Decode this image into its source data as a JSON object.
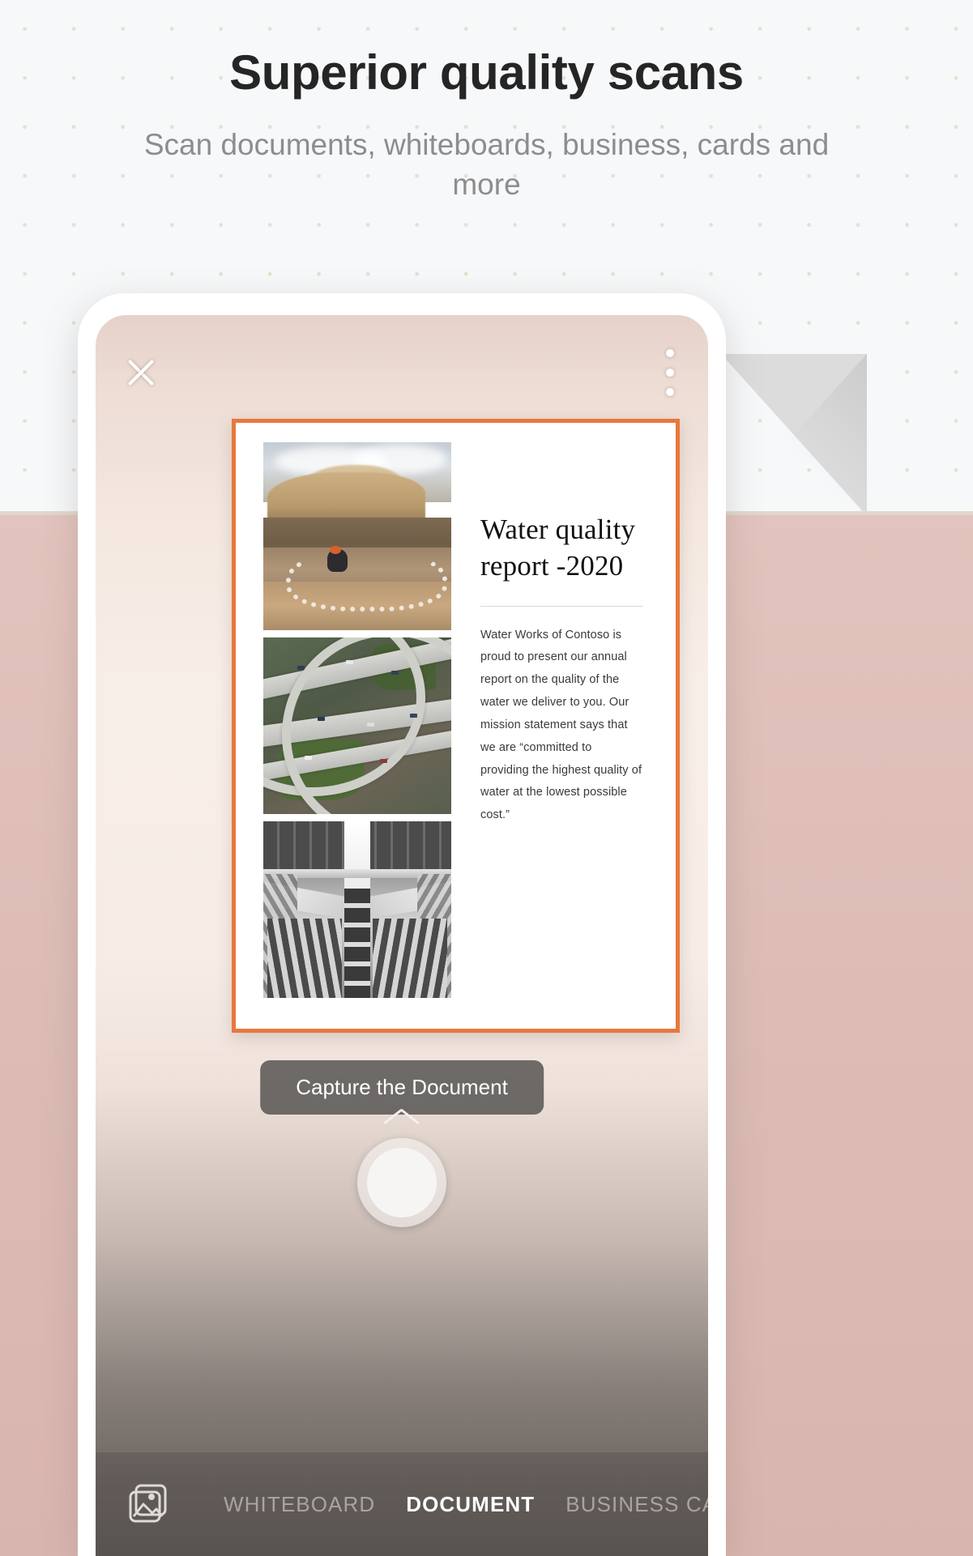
{
  "hero": {
    "headline": "Superior quality scans",
    "subhead": "Scan documents, whiteboards, business, cards and more"
  },
  "colors": {
    "accent_orange": "#e8783c",
    "page_bg_top": "#f6f8fa",
    "page_bg_bottom": "#debdb7",
    "dot_color": "#e6e0cf",
    "pill_bg": "#545250"
  },
  "phone": {
    "topbar": {
      "close_icon": "close-icon",
      "more_icon": "more-vertical-icon",
      "flash_icon": "flash-auto-icon"
    },
    "capture_hint": "Capture the Document",
    "chevron_icon": "chevron-up-icon",
    "shutter_label": "shutter-button",
    "gallery_icon": "gallery-icon",
    "modes": [
      {
        "label": "WHITEBOARD",
        "active": false
      },
      {
        "label": "DOCUMENT",
        "active": true
      },
      {
        "label": "BUSINESS CARD",
        "active": false
      }
    ]
  },
  "document": {
    "title": "Water quality report -2020",
    "body": "Water Works of Contoso is proud to present our annual report on the quality of the water we deliver to you. Our mission statement says that we are “committed to providing the highest quality of water at the lowest possible cost.”",
    "photos": [
      {
        "name": "wetland-erosion-photo"
      },
      {
        "name": "aerial-highway-interchange-photo"
      },
      {
        "name": "architecture-atrium-photo"
      }
    ]
  }
}
